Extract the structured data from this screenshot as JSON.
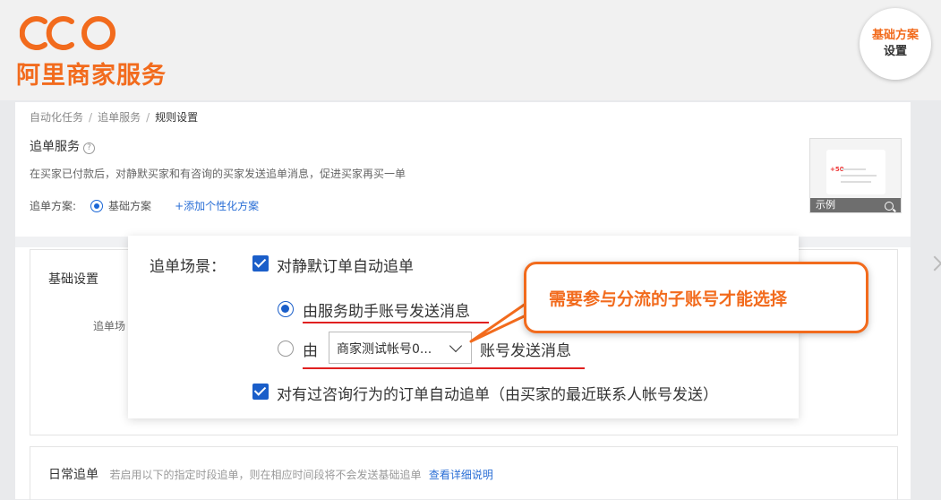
{
  "brand": {
    "logo_text": "阿里商家服务",
    "badge_line1": "基础方案",
    "badge_line2": "设置",
    "accent": "#f26b1d"
  },
  "breadcrumb": [
    "自动化任务",
    "追单服务",
    "规则设置"
  ],
  "service": {
    "title": "追单服务",
    "description": "在买家已付款后，对静默买家和有咨询的买家发送追单消息，促进买家再买一单",
    "plan_label": "追单方案:",
    "plan_selected": "基础方案",
    "add_plan_link": "+添加个性化方案",
    "preview_label": "示例",
    "preview_amount": "+50"
  },
  "basic_settings": {
    "title": "基础设置",
    "row_label": "追单场"
  },
  "daily": {
    "title": "日常追单",
    "note": "若启用以下的指定时段追单，则在相应时间段将不会发送基础追单",
    "link": "查看详细说明"
  },
  "zoom_panel": {
    "scene_label": "追单场景：",
    "silent_option": "对静默订单自动追单",
    "via_helper_option": "由服务助手账号发送消息",
    "via_prefix": "由",
    "account_select_value": "商家测试帐号0...",
    "via_suffix": "账号发送消息",
    "consult_option": "对有过咨询行为的订单自动追单（由买家的最近联系人帐号发送）"
  },
  "callout": {
    "text": "需要参与分流的子账号才能选择"
  },
  "colors": {
    "primary_blue": "#1a5ec9",
    "link_blue": "#2b6fd6",
    "underline_red": "#e02020"
  }
}
